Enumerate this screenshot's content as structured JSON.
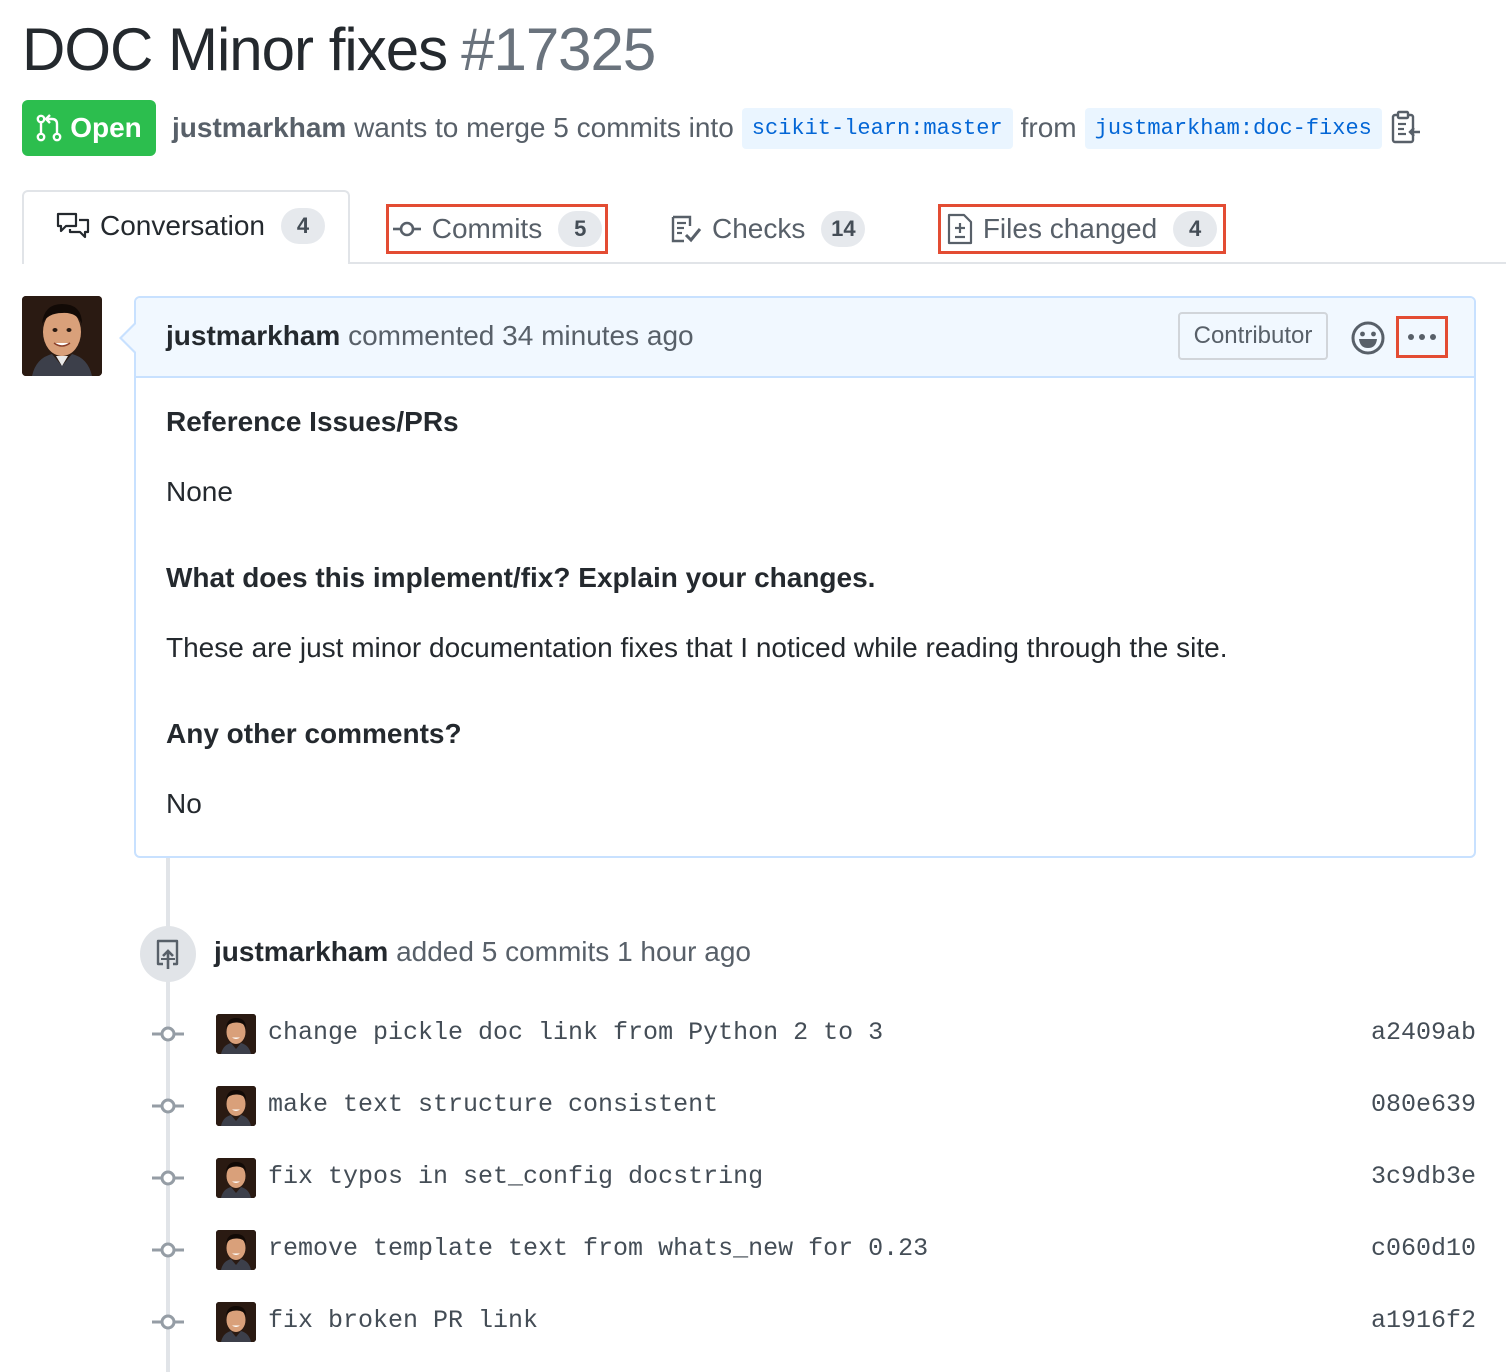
{
  "pr": {
    "title": "DOC Minor fixes",
    "number": "#17325",
    "state": "Open",
    "author": "justmarkham",
    "merge_text": "wants to merge 5 commits into",
    "base_branch": "scikit-learn:master",
    "from_text": "from",
    "head_branch": "justmarkham:doc-fixes"
  },
  "tabs": [
    {
      "label": "Conversation",
      "count": "4",
      "icon": "comment-discussion-icon"
    },
    {
      "label": "Commits",
      "count": "5",
      "icon": "git-commit-icon"
    },
    {
      "label": "Checks",
      "count": "14",
      "icon": "checklist-icon"
    },
    {
      "label": "Files changed",
      "count": "4",
      "icon": "file-diff-icon"
    }
  ],
  "comment": {
    "author": "justmarkham",
    "action": "commented 34 minutes ago",
    "badge": "Contributor",
    "body": {
      "h1": "Reference Issues/PRs",
      "p1": "None",
      "h2": "What does this implement/fix? Explain your changes.",
      "p2": "These are just minor documentation fixes that I noticed while reading through the site.",
      "h3": "Any other comments?",
      "p3": "No"
    }
  },
  "push_event": {
    "author": "justmarkham",
    "action": "added 5 commits 1 hour ago"
  },
  "commits": [
    {
      "message": "change pickle doc link from Python 2 to 3",
      "sha": "a2409ab"
    },
    {
      "message": "make text structure consistent",
      "sha": "080e639"
    },
    {
      "message": "fix typos in set_config docstring",
      "sha": "3c9db3e"
    },
    {
      "message": "remove template text from whats_new for 0.23",
      "sha": "c060d10"
    },
    {
      "message": "fix broken PR link",
      "sha": "a1916f2"
    }
  ],
  "colors": {
    "open_green": "#2cbe4e",
    "highlight_red": "#e34c33",
    "link_blue": "#0366d6",
    "comment_header_bg": "#f1f8ff"
  }
}
